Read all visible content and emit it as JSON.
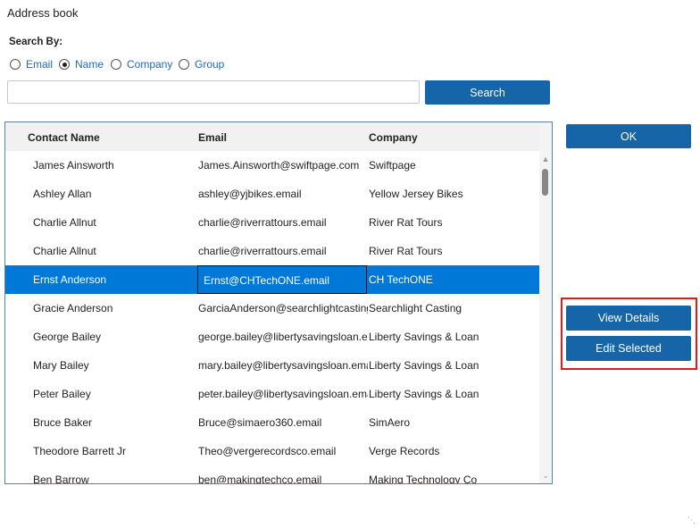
{
  "window": {
    "title": "Address book"
  },
  "search": {
    "label": "Search By:",
    "options": [
      "Email",
      "Name",
      "Company",
      "Group"
    ],
    "selected": "Name",
    "value": "",
    "button": "Search"
  },
  "table": {
    "headers": [
      "Contact Name",
      "Email",
      "Company"
    ],
    "rows": [
      [
        "James Ainsworth",
        "James.Ainsworth@swiftpage.com",
        "Swiftpage"
      ],
      [
        "Ashley Allan",
        "ashley@yjbikes.email",
        "Yellow Jersey Bikes"
      ],
      [
        "Charlie Allnut",
        "charlie@riverrattours.email",
        "River Rat Tours"
      ],
      [
        "Charlie Allnut",
        "charlie@riverrattours.email",
        "River Rat Tours"
      ],
      [
        "Ernst Anderson",
        "Ernst@CHTechONE.email",
        "CH TechONE"
      ],
      [
        "Gracie Anderson",
        "GarciaAnderson@searchlightcasting.email",
        "Searchlight Casting"
      ],
      [
        "George Bailey",
        "george.bailey@libertysavingsloan.email",
        "Liberty Savings & Loan"
      ],
      [
        "Mary Bailey",
        "mary.bailey@libertysavingsloan.email",
        "Liberty Savings & Loan"
      ],
      [
        "Peter Bailey",
        "peter.bailey@libertysavingsloan.email",
        "Liberty Savings & Loan"
      ],
      [
        "Bruce Baker",
        "Bruce@simaero360.email",
        "SimAero"
      ],
      [
        "Theodore Barrett Jr",
        "Theo@vergerecordsco.email",
        "Verge Records"
      ],
      [
        "Ben Barrow",
        "ben@makingtechco.email",
        "Making Technology Co"
      ]
    ],
    "selected_index": 4
  },
  "buttons": {
    "ok": "OK",
    "view_details": "View Details",
    "edit_selected": "Edit Selected"
  }
}
